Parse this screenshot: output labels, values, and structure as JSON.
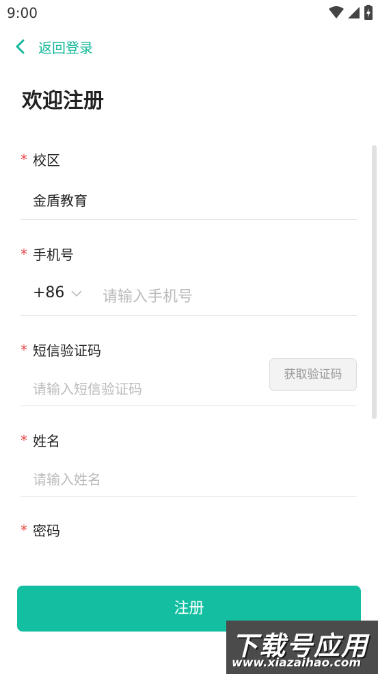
{
  "status_bar": {
    "time": "9:00"
  },
  "nav": {
    "back_label": "返回登录"
  },
  "page": {
    "title": "欢迎注册"
  },
  "form": {
    "required_marker": "*",
    "campus": {
      "label": "校区",
      "value": "金盾教育"
    },
    "phone": {
      "label": "手机号",
      "country_code": "+86",
      "placeholder": "请输入手机号"
    },
    "sms": {
      "label": "短信验证码",
      "placeholder": "请输入短信验证码",
      "get_code_label": "获取验证码"
    },
    "name": {
      "label": "姓名",
      "placeholder": "请输入姓名"
    },
    "password": {
      "label": "密码"
    }
  },
  "actions": {
    "register_label": "注册"
  },
  "watermark": {
    "title": "下载号应用",
    "url": "www.xiazaihao.com"
  },
  "colors": {
    "accent": "#14bfa1",
    "required": "#e94b4b",
    "placeholder": "#bbbbbb"
  }
}
